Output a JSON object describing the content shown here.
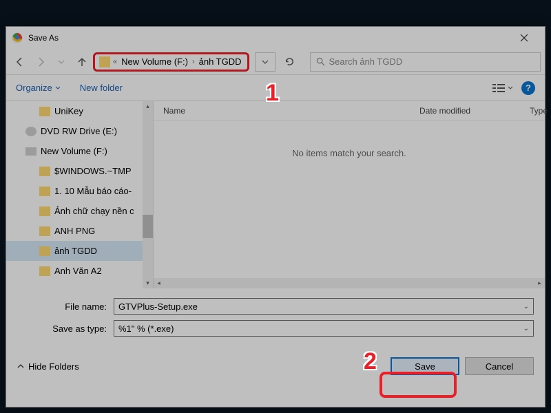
{
  "dialog": {
    "title": "Save As"
  },
  "breadcrumb": {
    "overflow": "«",
    "segments": [
      "New Volume (F:)",
      "ảnh TGDD"
    ]
  },
  "search": {
    "placeholder": "Search ảnh TGDD"
  },
  "toolbar": {
    "organize": "Organize",
    "new_folder": "New folder"
  },
  "tree": {
    "items": [
      {
        "label": "UniKey",
        "icon": "folder",
        "indent": 2
      },
      {
        "label": "DVD RW Drive (E:)",
        "icon": "disc",
        "indent": 1
      },
      {
        "label": "New Volume (F:)",
        "icon": "drive",
        "indent": 1
      },
      {
        "label": "$WINDOWS.~TMP",
        "icon": "folder",
        "indent": 2
      },
      {
        "label": "1. 10 Mẫu báo cáo-",
        "icon": "folder",
        "indent": 2
      },
      {
        "label": "Ảnh chữ chạy nền c",
        "icon": "folder",
        "indent": 2
      },
      {
        "label": "ANH PNG",
        "icon": "folder",
        "indent": 2
      },
      {
        "label": "ảnh TGDD",
        "icon": "folder",
        "indent": 2,
        "selected": true
      },
      {
        "label": "Anh Văn A2",
        "icon": "folder",
        "indent": 2
      }
    ]
  },
  "list": {
    "columns": {
      "name": "Name",
      "date": "Date modified",
      "type": "Type"
    },
    "empty_message": "No items match your search."
  },
  "form": {
    "filename_label": "File name:",
    "filename_value": "GTVPlus-Setup.exe",
    "savetype_label": "Save as type:",
    "savetype_value": "%1\" % (*.exe)"
  },
  "footer": {
    "hide_folders": "Hide Folders",
    "save": "Save",
    "cancel": "Cancel"
  },
  "callouts": {
    "one": "1",
    "two": "2"
  }
}
